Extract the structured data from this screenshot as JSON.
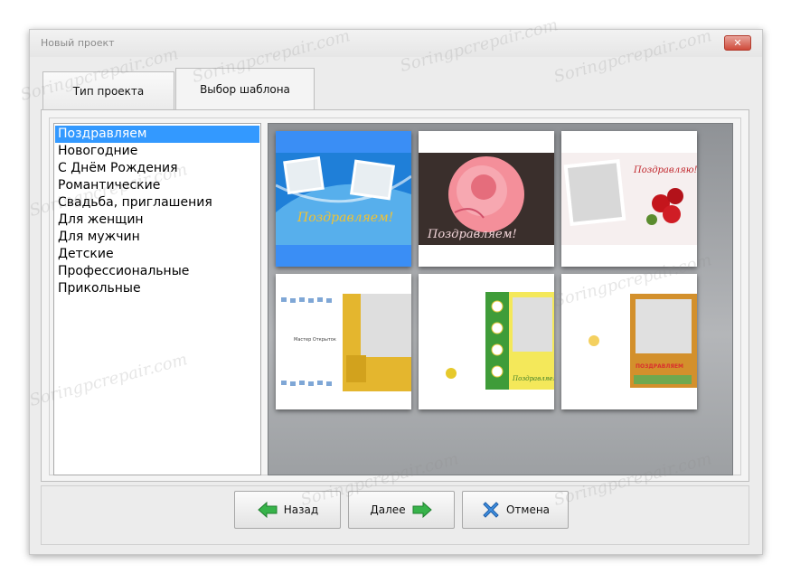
{
  "window": {
    "title": "Новый проект",
    "close_label": "✕"
  },
  "tabs": [
    {
      "label": "Тип проекта",
      "active": false
    },
    {
      "label": "Выбор шаблона",
      "active": true
    }
  ],
  "categories": [
    {
      "label": "Поздравляем",
      "selected": true
    },
    {
      "label": "Новогодние",
      "selected": false
    },
    {
      "label": "С Днём Рождения",
      "selected": false
    },
    {
      "label": "Романтические",
      "selected": false
    },
    {
      "label": "Свадьба, приглашения",
      "selected": false
    },
    {
      "label": "Для женщин",
      "selected": false
    },
    {
      "label": "Для мужчин",
      "selected": false
    },
    {
      "label": "Детские",
      "selected": false
    },
    {
      "label": "Профессиональные",
      "selected": false
    },
    {
      "label": "Прикольные",
      "selected": false
    }
  ],
  "templates": [
    {
      "caption": "Поздравляем!",
      "selected": true
    },
    {
      "caption": "Поздравляем!",
      "selected": false
    },
    {
      "caption": "Поздравляю!",
      "selected": false
    },
    {
      "caption": "Мастер Открыток",
      "selected": false
    },
    {
      "caption": "Поздравляем",
      "selected": false
    },
    {
      "caption": "ПОЗДРАВЛЯЕМ",
      "selected": false
    }
  ],
  "buttons": {
    "back": "Назад",
    "next": "Далее",
    "cancel": "Отмена"
  },
  "watermark": "Soringpcrepair.com",
  "colors": {
    "selection": "#3399ff",
    "arrow_green": "#37b34a",
    "cancel_blue": "#3f8fe0"
  }
}
